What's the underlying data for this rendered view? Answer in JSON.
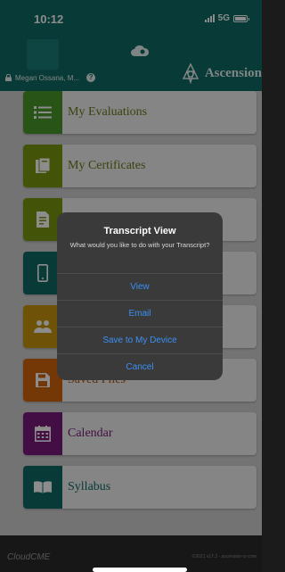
{
  "status_bar": {
    "time": "10:12",
    "network": "5G"
  },
  "header": {
    "user_name": "Megan Ossana, M...",
    "help_icon": "?",
    "brand_name": "Ascension"
  },
  "menu": {
    "items": [
      {
        "label": "My Evaluations",
        "icon": "list-icon",
        "icon_color": "#4a9a2a",
        "label_color": "#6a7a1a"
      },
      {
        "label": "My Certificates",
        "icon": "certificate-icon",
        "icon_color": "#7b9a12",
        "label_color": "#6a7a1a"
      },
      {
        "label": "",
        "icon": "transcript-icon",
        "icon_color": "#7b9a12",
        "label_color": "#6a7a1a"
      },
      {
        "label": "",
        "icon": "mobile-icon",
        "icon_color": "#0f6a64",
        "label_color": "#0f6a64"
      },
      {
        "label": "",
        "icon": "people-icon",
        "icon_color": "#c9950d",
        "label_color": "#9a7a10"
      },
      {
        "label": "Saved Files",
        "icon": "save-icon",
        "icon_color": "#d4670e",
        "label_color": "#b3560c"
      },
      {
        "label": "Calendar",
        "icon": "calendar-icon",
        "icon_color": "#7a1a7a",
        "label_color": "#7a1a7a"
      },
      {
        "label": "Syllabus",
        "icon": "book-icon",
        "icon_color": "#0f6a64",
        "label_color": "#0f6a64"
      }
    ]
  },
  "dialog": {
    "title": "Transcript View",
    "message": "What would you like to do with your Transcript?",
    "actions": [
      "View",
      "Email",
      "Save to My Device",
      "Cancel"
    ]
  },
  "footer": {
    "logo": "CloudCME",
    "version": "©2021 v17.2 - ascension-cr-cme"
  },
  "colors": {
    "accent": "#0f6a64",
    "action_blue": "#3a90f5"
  }
}
